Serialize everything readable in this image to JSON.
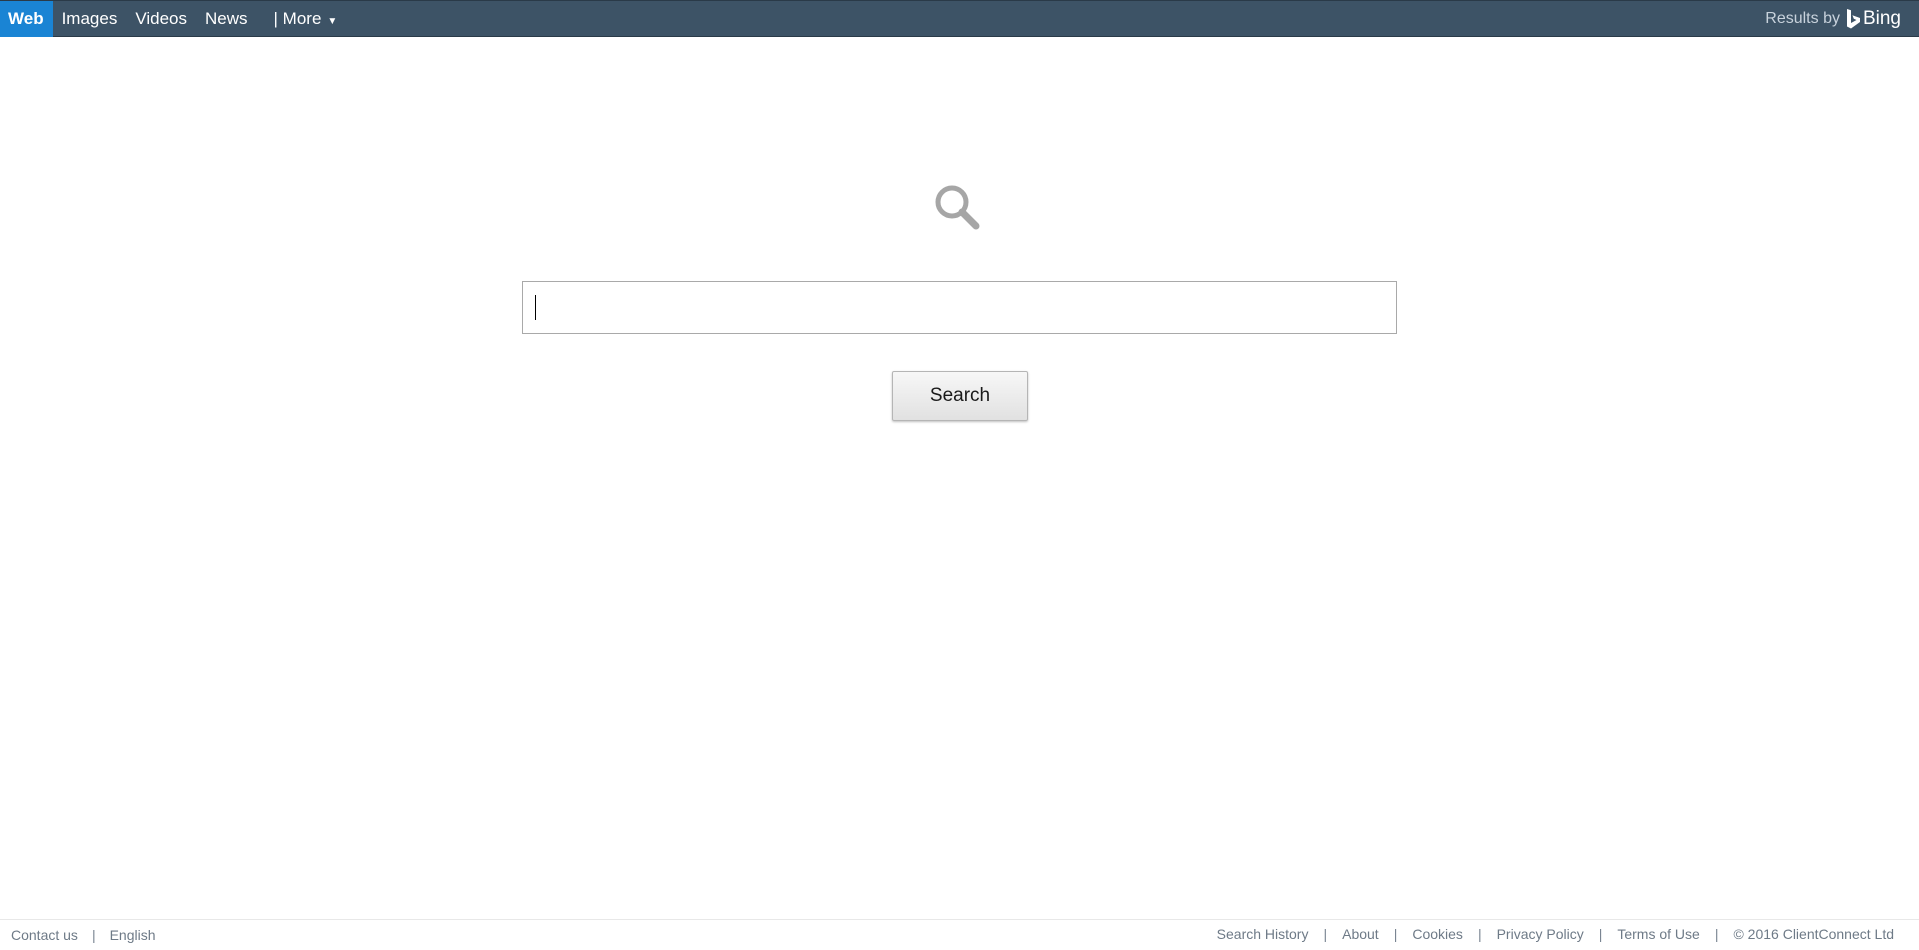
{
  "nav": {
    "items": [
      {
        "label": "Web",
        "active": true
      },
      {
        "label": "Images",
        "active": false
      },
      {
        "label": "Videos",
        "active": false
      },
      {
        "label": "News",
        "active": false
      }
    ],
    "more_label": "| More",
    "more_caret": "▼"
  },
  "branding": {
    "results_by": "Results by",
    "bing_label": "Bing"
  },
  "search": {
    "input_value": "",
    "button_label": "Search",
    "icon": "magnifying-glass-icon"
  },
  "footer": {
    "left": [
      {
        "label": "Contact us"
      },
      {
        "label": "English"
      }
    ],
    "right": [
      {
        "label": "Search History"
      },
      {
        "label": "About"
      },
      {
        "label": "Cookies"
      },
      {
        "label": "Privacy Policy"
      },
      {
        "label": "Terms of Use"
      }
    ],
    "separator": "|",
    "copyright": "© 2016 ClientConnect Ltd"
  },
  "colors": {
    "topbar": "#3d5366",
    "active_tab": "#1a84d4",
    "footer_text": "#6e7a87"
  }
}
